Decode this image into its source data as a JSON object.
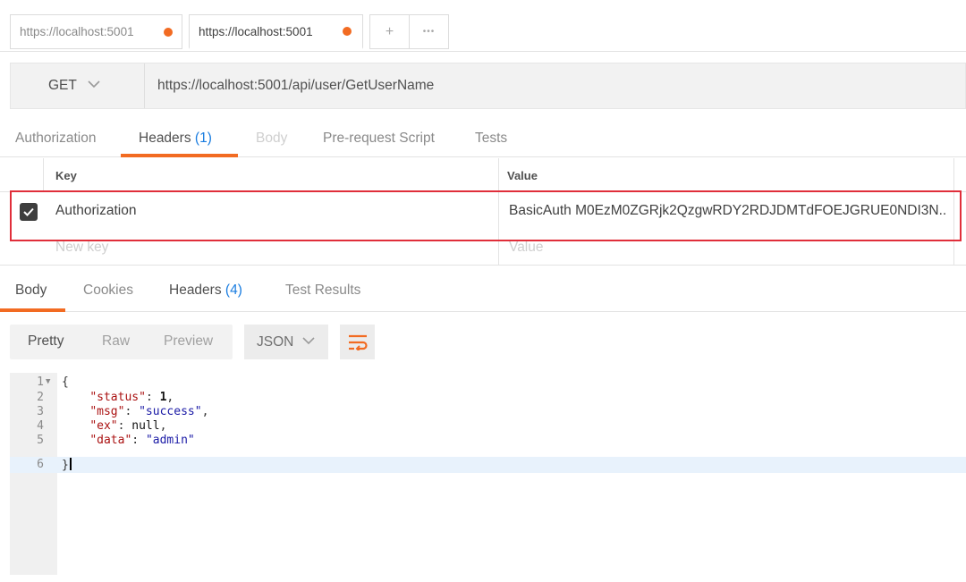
{
  "tabs": [
    {
      "label": "https://localhost:5001",
      "active": false
    },
    {
      "label": "https://localhost:5001",
      "active": true
    }
  ],
  "tab_controls": {
    "add": "+",
    "more": "•••"
  },
  "request": {
    "method": "GET",
    "url": "https://localhost:5001/api/user/GetUserName"
  },
  "request_tabs": {
    "authorization": "Authorization",
    "headers": "Headers",
    "headers_count": "(1)",
    "body": "Body",
    "prerequest": "Pre-request Script",
    "tests": "Tests"
  },
  "headers_table": {
    "key_header": "Key",
    "value_header": "Value",
    "rows": [
      {
        "checked": true,
        "key": "Authorization",
        "value": "BasicAuth M0EzM0ZGRjk2QzgwRDY2RDJDMTdFOEJGRUE0NDI3N..."
      }
    ],
    "new_key_placeholder": "New key",
    "new_value_placeholder": "Value"
  },
  "response_tabs": {
    "body": "Body",
    "cookies": "Cookies",
    "headers": "Headers",
    "headers_count": "(4)",
    "test_results": "Test Results"
  },
  "view_modes": {
    "pretty": "Pretty",
    "raw": "Raw",
    "preview": "Preview",
    "selected": "Pretty"
  },
  "format": "JSON",
  "code_lines": [
    "1",
    "2",
    "3",
    "4",
    "5",
    "6"
  ],
  "response_json": {
    "open": "{",
    "status_key": "\"status\"",
    "status_val": "1",
    "msg_key": "\"msg\"",
    "msg_val": "\"success\"",
    "ex_key": "\"ex\"",
    "ex_val": "null",
    "data_key": "\"data\"",
    "data_val": "\"admin\"",
    "close": "}"
  },
  "colors": {
    "accent": "#f26b22",
    "count": "#1a7de0",
    "highlight_box": "#e02e3a"
  }
}
